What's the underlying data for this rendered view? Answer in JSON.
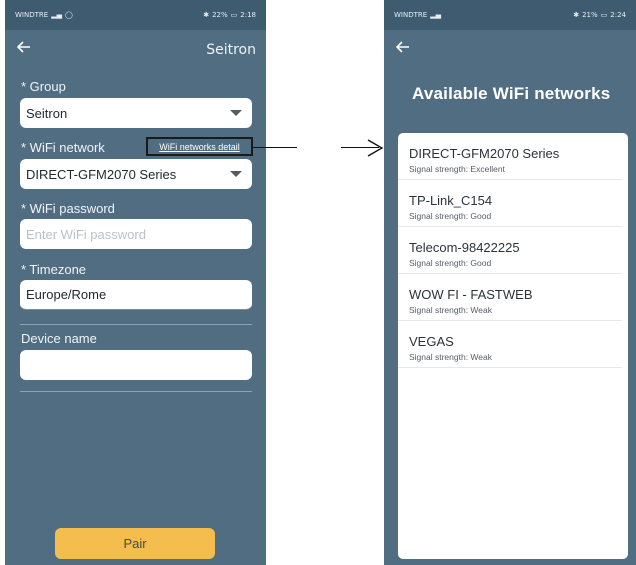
{
  "left_screen": {
    "status_bar": {
      "carrier": "WINDTRE",
      "battery": "22%",
      "time": "2:18"
    },
    "header_title": "Seitron",
    "group": {
      "label": "* Group",
      "value": "Seitron"
    },
    "wifi_network": {
      "label": "* WiFi network",
      "value": "DIRECT-GFM2070 Series",
      "detail_link": "WiFi networks detail"
    },
    "wifi_password": {
      "label": "* WiFi password",
      "placeholder": "Enter WiFi password"
    },
    "timezone": {
      "label": "* Timezone",
      "value": "Europe/Rome"
    },
    "device_name": {
      "label": "Device name",
      "value": ""
    },
    "pair_button": "Pair"
  },
  "right_screen": {
    "status_bar": {
      "carrier": "WINDTRE",
      "battery": "21%",
      "time": "2:24"
    },
    "title": "Available WiFi networks",
    "networks": [
      {
        "name": "DIRECT-GFM2070 Series",
        "signal": "Signal strength: Excellent"
      },
      {
        "name": "TP-Link_C154",
        "signal": "Signal strength: Good"
      },
      {
        "name": "Telecom-98422225",
        "signal": "Signal strength: Good"
      },
      {
        "name": "WOW FI - FASTWEB",
        "signal": "Signal strength: Weak"
      },
      {
        "name": "VEGAS",
        "signal": "Signal strength: Weak"
      }
    ]
  },
  "icons": {
    "back": "arrow-left-icon",
    "dropdown": "chevron-down-icon",
    "connector": "arrow-right-icon"
  },
  "colors": {
    "app_background": "#516d82",
    "status_bar": "#3f5b70",
    "pair_button": "#f5bd4d"
  }
}
